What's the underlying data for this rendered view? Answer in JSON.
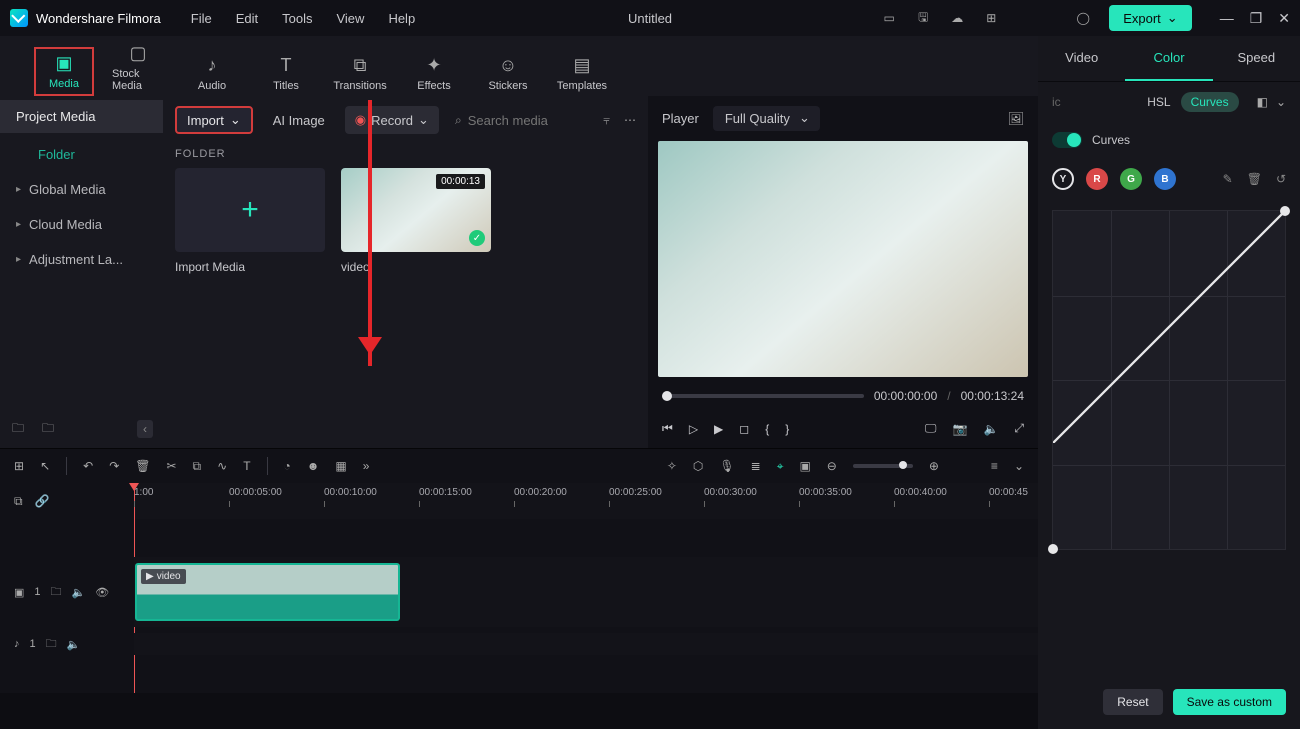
{
  "titlebar": {
    "brand": "Wondershare Filmora",
    "menu": [
      "File",
      "Edit",
      "Tools",
      "View",
      "Help"
    ],
    "doc": "Untitled",
    "export": "Export"
  },
  "cats": [
    {
      "l": "Media"
    },
    {
      "l": "Stock Media"
    },
    {
      "l": "Audio"
    },
    {
      "l": "Titles"
    },
    {
      "l": "Transitions"
    },
    {
      "l": "Effects"
    },
    {
      "l": "Stickers"
    },
    {
      "l": "Templates"
    }
  ],
  "sidebar": {
    "project": "Project Media",
    "folder": "Folder",
    "items": [
      "Global Media",
      "Cloud Media",
      "Adjustment La..."
    ]
  },
  "mediabar": {
    "import": "Import",
    "ai": "AI Image",
    "record": "Record",
    "search": "Search media"
  },
  "grid": {
    "header": "FOLDER",
    "items": [
      {
        "caption": "Import Media",
        "thumb": "plus"
      },
      {
        "caption": "video",
        "thumb": "vid",
        "dur": "00:00:13",
        "checked": true
      }
    ]
  },
  "preview": {
    "player": "Player",
    "quality": "Full Quality",
    "time_cur": "00:00:00:00",
    "time_total": "00:00:13:24",
    "sep": "/"
  },
  "right": {
    "tabs": [
      "Video",
      "Color",
      "Speed"
    ],
    "sub_fade": "ic",
    "sub_hsl": "HSL",
    "sub_curves": "Curves",
    "toggle": "Curves",
    "channels": [
      "Y",
      "R",
      "G",
      "B"
    ],
    "reset": "Reset",
    "save": "Save as custom"
  },
  "ruler": [
    "1:00",
    "00:00:05:00",
    "00:00:10:00",
    "00:00:15:00",
    "00:00:20:00",
    "00:00:25:00",
    "00:00:30:00",
    "00:00:35:00",
    "00:00:40:00",
    "00:00:45"
  ],
  "clip": {
    "label": "video"
  },
  "tracks": {
    "v": "1",
    "a": "1"
  }
}
